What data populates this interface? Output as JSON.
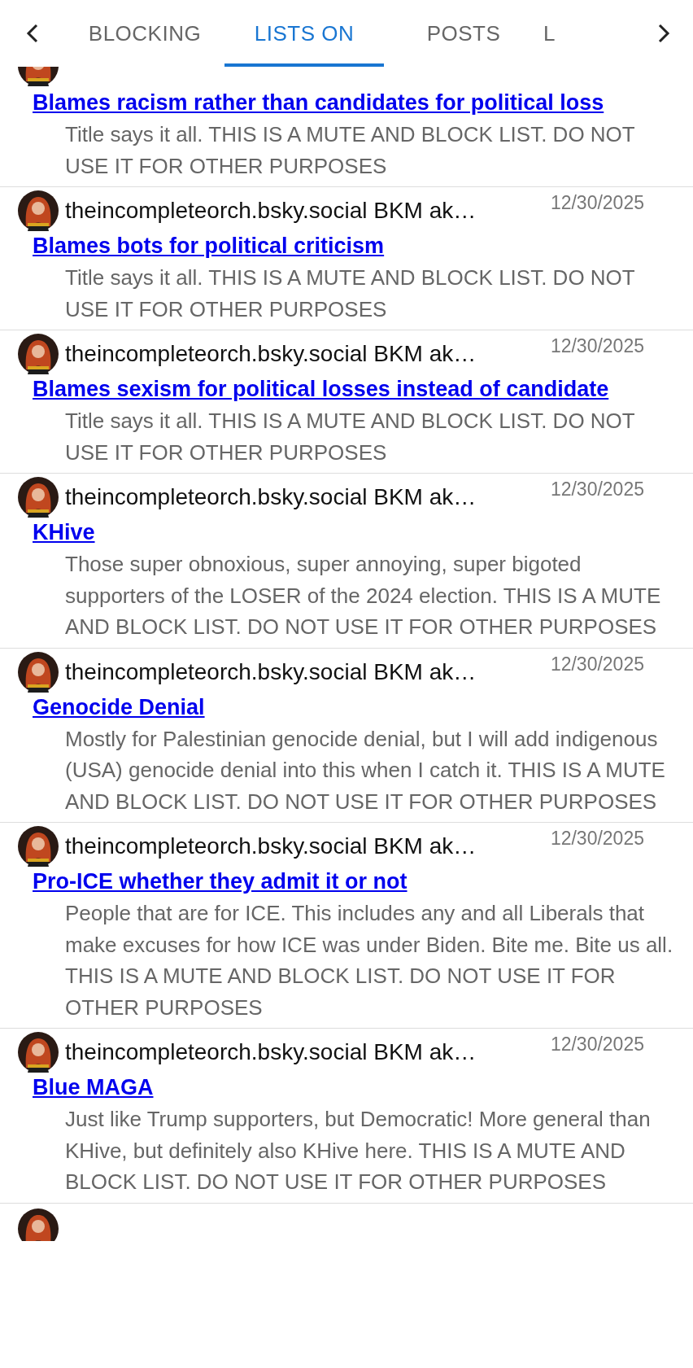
{
  "tabs": [
    {
      "label": "BLOCKING",
      "selected": false
    },
    {
      "label": "LISTS ON",
      "selected": true
    },
    {
      "label": "POSTS",
      "selected": false
    },
    {
      "label": "L",
      "selected": false
    }
  ],
  "lists": [
    {
      "kind": "clipped-top",
      "title": "Blames racism rather than candidates for political loss",
      "description": "Title says it all. THIS IS A MUTE AND BLOCK LIST. DO NOT USE IT FOR OTHER PURPOSES"
    },
    {
      "kind": "full",
      "author": "theincompleteorch.bsky.social BKM ak…",
      "date": "12/30/2025",
      "title": "Blames bots for political criticism",
      "description": "Title says it all. THIS IS A MUTE AND BLOCK LIST. DO NOT USE IT FOR OTHER PURPOSES"
    },
    {
      "kind": "full",
      "author": "theincompleteorch.bsky.social BKM ak…",
      "date": "12/30/2025",
      "title": "Blames sexism for political losses instead of candidate",
      "description": "Title says it all. THIS IS A MUTE AND BLOCK LIST. DO NOT USE IT FOR OTHER PURPOSES"
    },
    {
      "kind": "full",
      "author": "theincompleteorch.bsky.social BKM ak…",
      "date": "12/30/2025",
      "title": "KHive",
      "description": "Those super obnoxious, super annoying, super bigoted supporters of the LOSER of the 2024 election. THIS IS A MUTE AND BLOCK LIST. DO NOT USE IT FOR OTHER PURPOSES"
    },
    {
      "kind": "full",
      "author": "theincompleteorch.bsky.social BKM ak…",
      "date": "12/30/2025",
      "title": "Genocide Denial",
      "description": "Mostly for Palestinian genocide denial, but I will add indigenous (USA) genocide denial into this when I catch it. THIS IS A MUTE AND BLOCK LIST. DO NOT USE IT FOR OTHER PURPOSES"
    },
    {
      "kind": "full",
      "author": "theincompleteorch.bsky.social BKM ak…",
      "date": "12/30/2025",
      "title": "Pro-ICE whether they admit it or not",
      "description": "People that are for ICE. This includes any and all Liberals that make excuses for how ICE was under Biden. Bite me. Bite us all. THIS IS A MUTE AND BLOCK LIST. DO NOT USE IT FOR OTHER PURPOSES"
    },
    {
      "kind": "full",
      "author": "theincompleteorch.bsky.social BKM ak…",
      "date": "12/30/2025",
      "title": "Blue MAGA",
      "description": "Just like Trump supporters, but Democratic! More general than KHive, but definitely also KHive here. THIS IS A MUTE AND BLOCK LIST. DO NOT USE IT FOR OTHER PURPOSES"
    },
    {
      "kind": "clipped-bottom"
    }
  ]
}
